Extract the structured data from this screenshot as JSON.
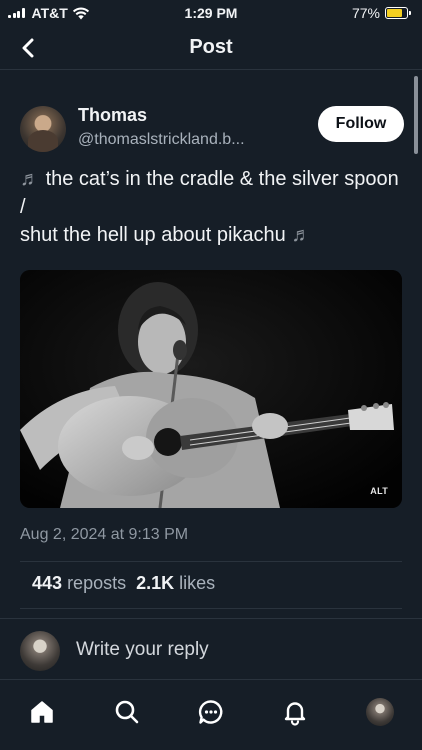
{
  "status_bar": {
    "carrier": "AT&T",
    "time": "1:29 PM",
    "battery_percent": "77%",
    "battery_level": 0.77,
    "battery_color": "#f5d021"
  },
  "header": {
    "title": "Post",
    "back_icon": "chevron-left-icon"
  },
  "post": {
    "author": {
      "name": "Thomas",
      "handle": "@thomaslstrickland.b..."
    },
    "follow_label": "Follow",
    "text_line1": "the cat’s in the cradle & the silver spoon /",
    "text_line2": "shut the hell up about pikachu",
    "music_note_icon": "♬",
    "image": {
      "alt_badge": "ALT"
    },
    "timestamp": "Aug 2, 2024 at 9:13 PM",
    "stats": {
      "reposts_count": "443",
      "reposts_label": "reposts",
      "likes_count": "2.1K",
      "likes_label": "likes"
    }
  },
  "reply": {
    "placeholder": "Write your reply"
  },
  "tab_bar": {
    "items": [
      "home-icon",
      "search-icon",
      "chat-icon",
      "bell-icon",
      "profile-avatar"
    ]
  },
  "colors": {
    "background": "#161e27",
    "text": "#f1f3f5",
    "secondary_text": "#8f98a2",
    "divider": "#2a333d"
  }
}
